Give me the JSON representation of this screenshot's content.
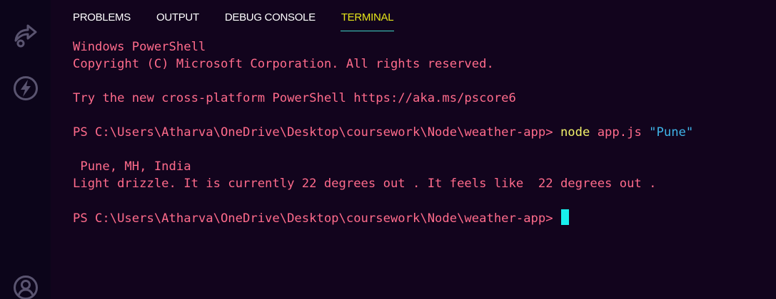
{
  "activity_bar": {
    "items": [
      {
        "name": "remote-explorer-icon"
      },
      {
        "name": "thunder-icon"
      },
      {
        "name": "account-icon"
      }
    ],
    "icon_color": "#5a5470"
  },
  "panel": {
    "tabs": [
      {
        "label": "PROBLEMS",
        "active": false
      },
      {
        "label": "OUTPUT",
        "active": false
      },
      {
        "label": "DEBUG CONSOLE",
        "active": false
      },
      {
        "label": "TERMINAL",
        "active": true
      }
    ]
  },
  "terminal": {
    "colors": {
      "background": "#12041d",
      "text": "#ff6b8b",
      "command": "#f2f26a",
      "string": "#3fb4e8",
      "cursor": "#18f0ee",
      "active_tab": "#e5e51a",
      "tab_underline": "#3fd4c7"
    },
    "header_line_1": "Windows PowerShell",
    "header_line_2": "Copyright (C) Microsoft Corporation. All rights reserved.",
    "try_line": "Try the new cross-platform PowerShell https://aka.ms/pscore6",
    "prompt_1": "PS C:\\Users\\Atharva\\OneDrive\\Desktop\\coursework\\Node\\weather-app> ",
    "command_name": "node",
    "command_args": " app.js ",
    "command_string": "\"Pune\"",
    "output_location": " Pune, MH, India",
    "output_forecast": "Light drizzle. It is currently 22 degrees out . It feels like  22 degrees out .",
    "prompt_2": "PS C:\\Users\\Atharva\\OneDrive\\Desktop\\coursework\\Node\\weather-app> "
  }
}
